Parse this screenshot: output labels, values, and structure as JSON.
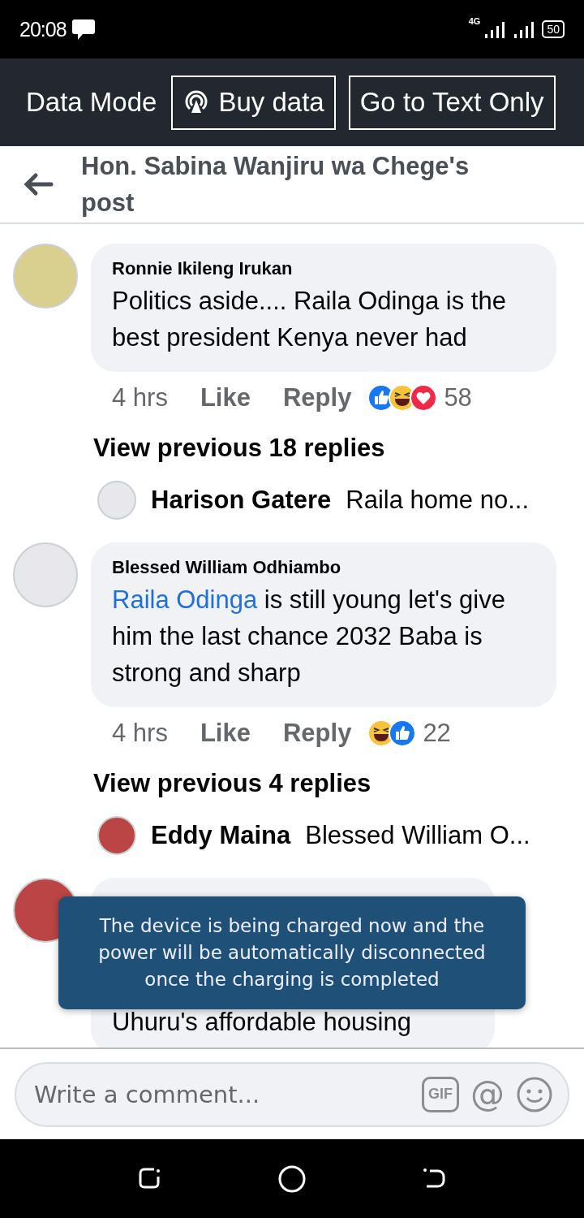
{
  "status_bar": {
    "time": "20:08",
    "network": "4G",
    "battery": "50"
  },
  "data_banner": {
    "label": "Data Mode",
    "buttons": [
      {
        "kind": "buy",
        "label": "Buy data"
      },
      {
        "kind": "plain",
        "label": "Go to Text Only"
      }
    ]
  },
  "header": {
    "title": "Hon. Sabina Wanjiru wa Chege's post"
  },
  "comments": [
    {
      "kind": "full",
      "author": "Ronnie Ikileng Irukan",
      "body_parts": [
        {
          "kind": "text",
          "text": "Politics aside.... Raila Odinga is the best president Kenya never had"
        }
      ],
      "time": "4 hrs",
      "actions": [
        "Like",
        "Reply"
      ],
      "reactions": [
        {
          "kind": "like"
        },
        {
          "kind": "haha"
        },
        {
          "kind": "love"
        }
      ],
      "reaction_count": "58",
      "more_replies": "View previous 18 replies",
      "latest_reply": {
        "author": "Harison Gatere",
        "text": "Raila home no..."
      }
    },
    {
      "kind": "full",
      "author": "Blessed William Odhiambo",
      "body_parts": [
        {
          "kind": "mention",
          "text": "Raila Odinga"
        },
        {
          "kind": "text",
          "text": " is still young let's give him the last chance 2032 Baba is strong and sharp"
        }
      ],
      "time": "4 hrs",
      "actions": [
        "Like",
        "Reply"
      ],
      "reactions": [
        {
          "kind": "haha"
        },
        {
          "kind": "like"
        }
      ],
      "reaction_count": "22",
      "more_replies": "View previous 4 replies",
      "latest_reply": {
        "author": "Eddy Maina",
        "text": "Blessed William O..."
      }
    },
    {
      "kind": "covered",
      "body_parts": [
        {
          "kind": "text",
          "text": "Uhuru's   affordable housing"
        }
      ]
    }
  ],
  "toast": {
    "text": "The device is being charged now and the power will be automatically disconnected once the charging is completed"
  },
  "composer": {
    "placeholder": "Write a comment...",
    "tools": [
      {
        "kind": "gif",
        "label": "GIF"
      },
      {
        "kind": "mention",
        "label": "@"
      },
      {
        "kind": "emoji"
      }
    ]
  }
}
